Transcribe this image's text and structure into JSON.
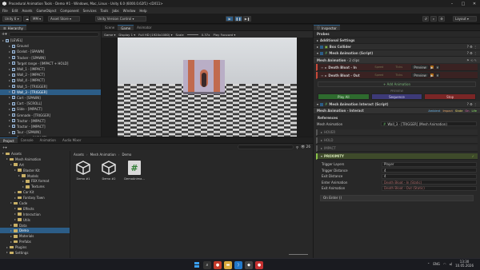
{
  "window": {
    "title": "Procedural Animation Tools - Demo #1 - Windows, Mac, Linux - Unity 6.0 (6000.0.62f1) <DX11>"
  },
  "menu": [
    "File",
    "Edit",
    "Assets",
    "GameObject",
    "Component",
    "Services",
    "Tools",
    "Jobs",
    "Window",
    "Help"
  ],
  "toolbar": {
    "account": "Unity 6",
    "mm": "MM",
    "asset_store": "Asset Store",
    "version_control": "Unity Version Control",
    "layout": "Layout"
  },
  "hierarchy": {
    "tab": "Hierarchy",
    "items": [
      {
        "label": "[LEVEL]",
        "depth": 0
      },
      {
        "label": "Ground",
        "depth": 1
      },
      {
        "label": "Ocelot - [SPAWN]",
        "depth": 1
      },
      {
        "label": "Tracker - [SPAWN]",
        "depth": 1
      },
      {
        "label": "Target range - [IMPACT + HOLD]",
        "depth": 1
      },
      {
        "label": "Wall_1 - [IMPACT]",
        "depth": 1
      },
      {
        "label": "Wall_2 - [IMPACT]",
        "depth": 1
      },
      {
        "label": "Wall_4 - [IMPACT]",
        "depth": 1
      },
      {
        "label": "Wall_5 - [TRIGGER]",
        "depth": 1
      },
      {
        "label": "Wall_3 - [TRIGGER]",
        "depth": 1,
        "selected": true
      },
      {
        "label": "Cart - [SPAWN]",
        "depth": 1
      },
      {
        "label": "Cart - [SCROLL]",
        "depth": 1
      },
      {
        "label": "Slide - [IMPACT]",
        "depth": 1
      },
      {
        "label": "Grenade - [TRIGGER]",
        "depth": 1
      },
      {
        "label": "Tractor - [IMPACT]",
        "depth": 1
      },
      {
        "label": "Tractor - [IMPACT]",
        "depth": 1
      },
      {
        "label": "Tour - [SPAWN]",
        "depth": 1
      },
      {
        "label": "Barriers - [IMPACT]",
        "depth": 1
      },
      {
        "label": "Car",
        "depth": 1
      },
      {
        "label": "Player",
        "depth": 0
      }
    ]
  },
  "center_tabs": [
    "Scene",
    "Game",
    "Animator"
  ],
  "game_bar": {
    "display": "Display 1",
    "resolution": "Full HD (1920x1080)",
    "scale_label": "Scale",
    "scale": "0.37x",
    "play_focused": "Play Focused"
  },
  "project": {
    "tabs": [
      "Project",
      "Console",
      "Animation",
      "Audio Mixer"
    ],
    "breadcrumb": [
      "Assets",
      "Mesh Animation",
      "Demo"
    ],
    "tree": [
      {
        "label": "Assets",
        "depth": 0
      },
      {
        "label": "Mesh Animation",
        "depth": 1
      },
      {
        "label": "Art",
        "depth": 2
      },
      {
        "label": "Blaster Kit",
        "depth": 3
      },
      {
        "label": "Models",
        "depth": 4
      },
      {
        "label": "FBX format",
        "depth": 5
      },
      {
        "label": "Textures",
        "depth": 5
      },
      {
        "label": "Car Kit",
        "depth": 3
      },
      {
        "label": "Fantasy Town",
        "depth": 3
      },
      {
        "label": "Code",
        "depth": 2
      },
      {
        "label": "Effects",
        "depth": 3
      },
      {
        "label": "Interaction",
        "depth": 3
      },
      {
        "label": "Utils",
        "depth": 3
      },
      {
        "label": "Data",
        "depth": 2
      },
      {
        "label": "Demo",
        "depth": 2,
        "selected": true
      },
      {
        "label": "Materials",
        "depth": 2
      },
      {
        "label": "Prefabs",
        "depth": 2
      },
      {
        "label": "Plugins",
        "depth": 1
      },
      {
        "label": "Settings",
        "depth": 1
      }
    ],
    "assets": [
      {
        "label": "Demo #1",
        "kind": "unity"
      },
      {
        "label": "Demo #2",
        "kind": "unity"
      },
      {
        "label": "DemoAnima...",
        "kind": "script"
      }
    ],
    "count": "26"
  },
  "inspector": {
    "tab": "Inspector",
    "probes": "Probes",
    "additional_settings": "Additional Settings",
    "box_collider": "Box Collider",
    "mesh_animation": "Mesh Animation (Script)",
    "clips_label": "Mesh Animation",
    "clips_count": "2 clips",
    "clips": [
      {
        "name": "Death Bloat - In",
        "speed": "Speed",
        "ticks": "Ticks"
      },
      {
        "name": "Death Bloat - Out",
        "speed": "Speed",
        "ticks": "Ticks"
      }
    ],
    "preview": "Preview",
    "add_animation": "+ Add Animation",
    "preview_header": "PREVIEW",
    "play_all": "Play All",
    "sequence": "Sequence",
    "stop": "Stop",
    "interact_header": "Mesh Animation Interact (Script)",
    "interact_title": "Mesh Animation - Interact",
    "interact_tabs": [
      "Ambient",
      "Impact",
      "State",
      "On",
      "Life"
    ],
    "references": "References",
    "ref_label": "Mesh Animation",
    "ref_value": "Wall_3 - [TRIGGER] (Mesh Animation)",
    "sections": [
      "HOVER",
      "HOLD",
      "IMPACT"
    ],
    "proximity": "PROXIMITY",
    "fields": [
      {
        "label": "Trigger Layers",
        "value": "Player"
      },
      {
        "label": "Trigger Distance",
        "value": "4"
      },
      {
        "label": "Exit Distance",
        "value": "4"
      },
      {
        "label": "Enter Animation",
        "value": "Death Bloat - In (Static)"
      },
      {
        "label": "Exit Animation",
        "value": "Death Bloat - Out (Static)"
      }
    ],
    "on_enter": "On Enter ()"
  },
  "taskbar": {
    "lang": "ENG",
    "time": "13:30",
    "date": "10.05.2026"
  }
}
